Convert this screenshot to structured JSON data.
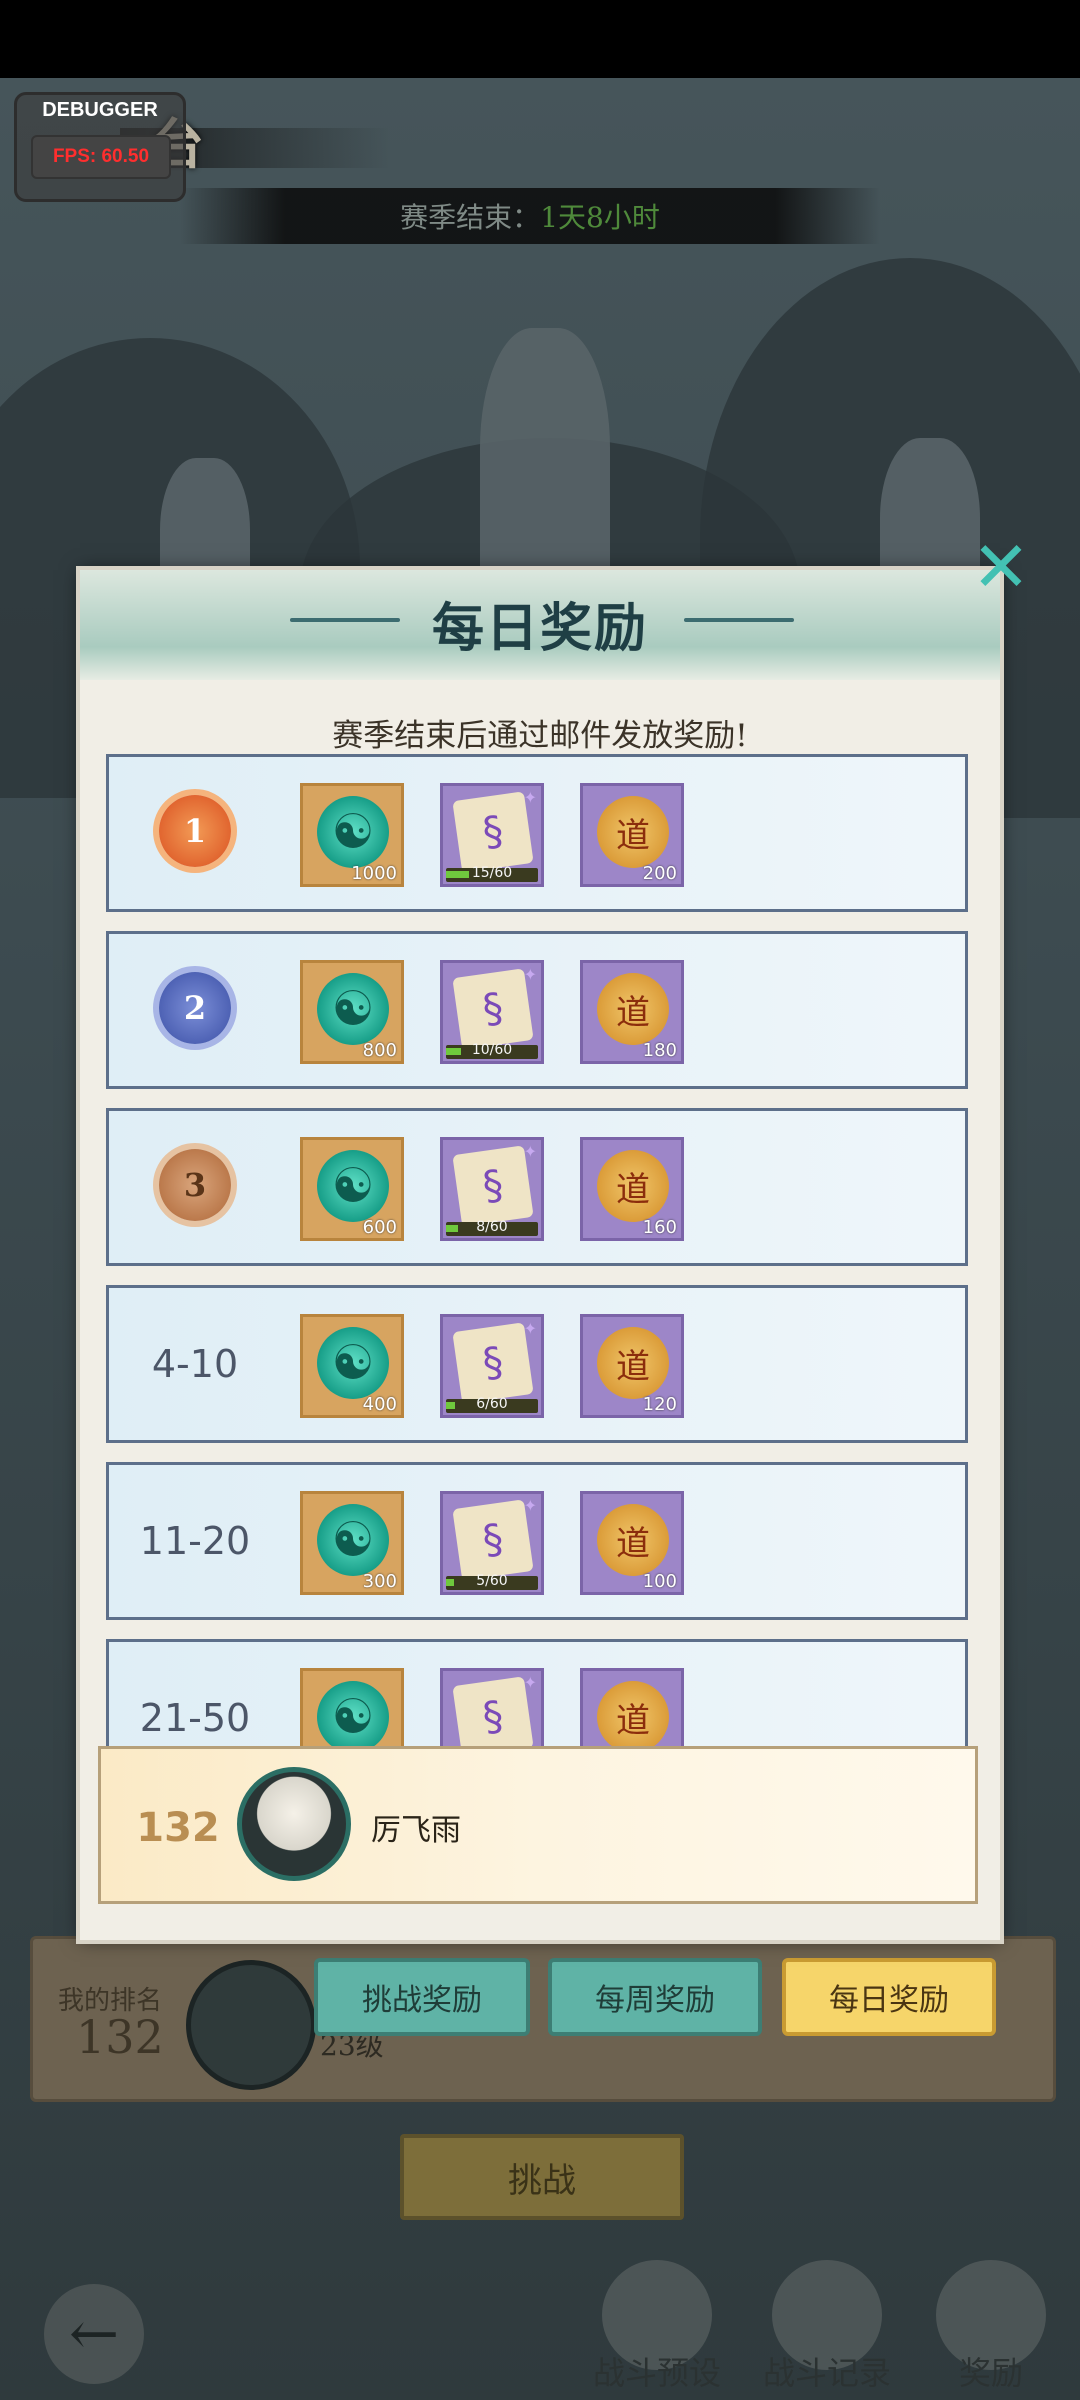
{
  "debugger": {
    "title": "DEBUGGER",
    "fps": "FPS: 60.50"
  },
  "arena": {
    "title": "台",
    "season_label": "赛季结束：",
    "season_time": "1天8小时"
  },
  "modal": {
    "title": "每日奖励",
    "subtitle": "赛季结束后通过邮件发放奖励!",
    "close_glyph": "✕",
    "rows": [
      {
        "rank": "1",
        "medal": "gold",
        "jade": "1000",
        "scroll_progress": "15/60",
        "scroll_fraction": 0.25,
        "token": "200"
      },
      {
        "rank": "2",
        "medal": "silver",
        "jade": "800",
        "scroll_progress": "10/60",
        "scroll_fraction": 0.167,
        "token": "180"
      },
      {
        "rank": "3",
        "medal": "bronze",
        "jade": "600",
        "scroll_progress": "8/60",
        "scroll_fraction": 0.133,
        "token": "160"
      },
      {
        "rank": "4-10",
        "medal": "",
        "jade": "400",
        "scroll_progress": "6/60",
        "scroll_fraction": 0.1,
        "token": "120"
      },
      {
        "rank": "11-20",
        "medal": "",
        "jade": "300",
        "scroll_progress": "5/60",
        "scroll_fraction": 0.083,
        "token": "100"
      },
      {
        "rank": "21-50",
        "medal": "",
        "jade": "",
        "scroll_progress": "",
        "scroll_fraction": 0,
        "token": ""
      }
    ],
    "my_rank": {
      "rank": "132",
      "name": "厉飞雨"
    }
  },
  "background_panel": {
    "my_rank_label": "我的排名",
    "my_rank_value": "132",
    "level": "23级",
    "tabs": {
      "challenge": "挑战奖励",
      "weekly": "每周奖励",
      "daily": "每日奖励"
    },
    "challenge_button": "挑战"
  },
  "bottom_nav": {
    "preset": "战斗预设",
    "record": "战斗记录",
    "reward": "奖励"
  },
  "icons": {
    "jade": "jade-dragon-icon",
    "scroll": "scroll-icon",
    "token": "dao-token-icon",
    "back": "back-arrow-icon"
  },
  "colors": {
    "accent_teal": "#5fb3a6",
    "accent_gold": "#f6d56a",
    "row_border": "#5d6f8a"
  }
}
